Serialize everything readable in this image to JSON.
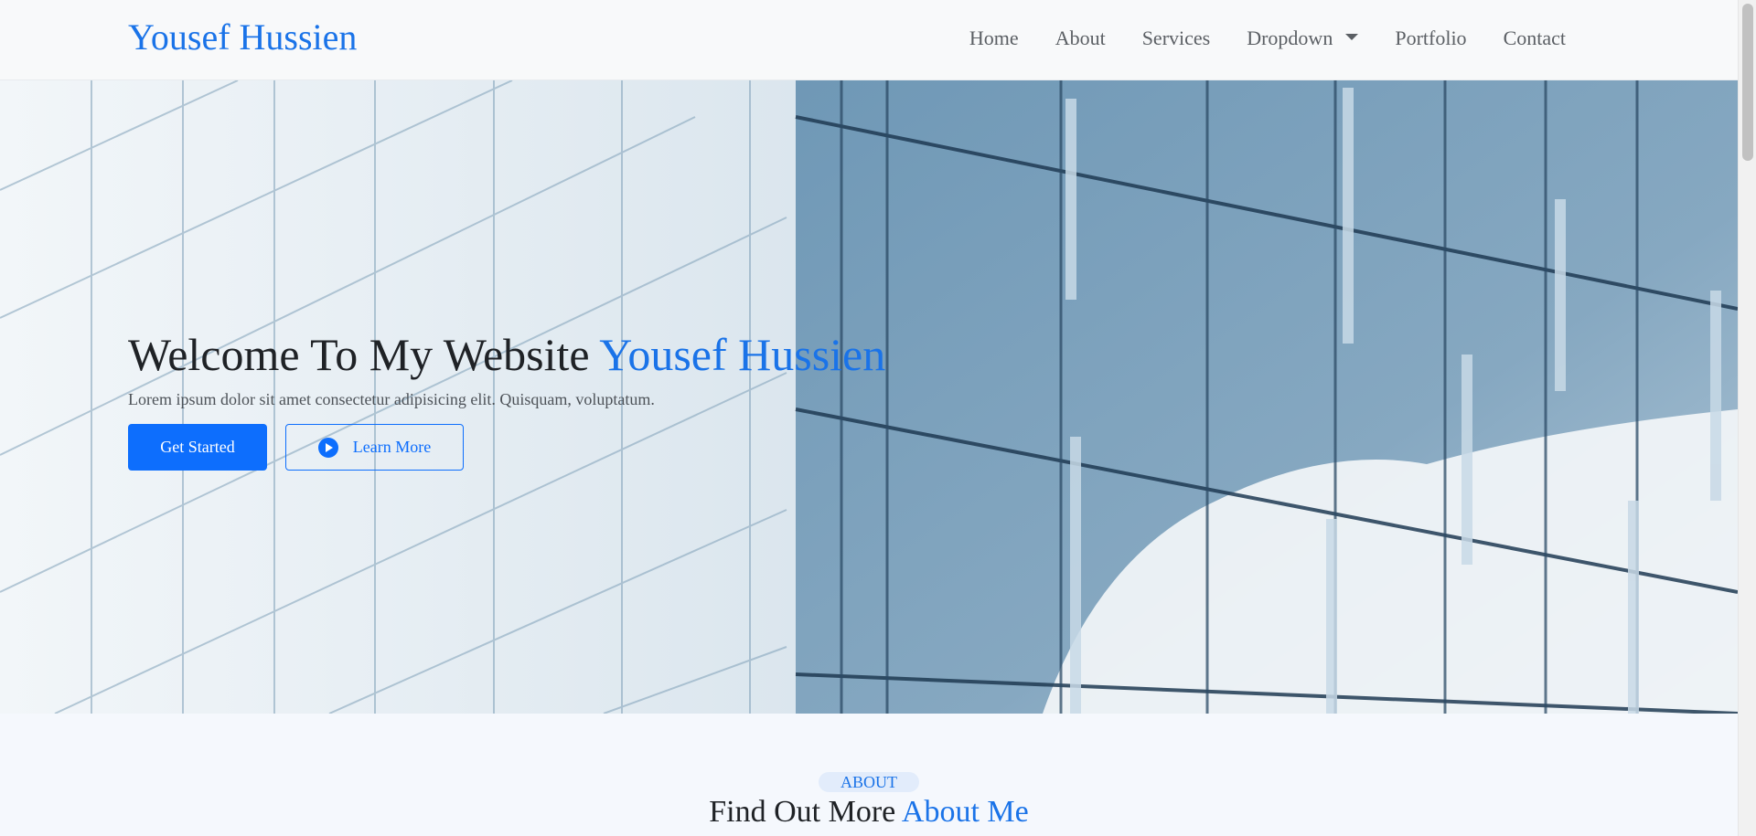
{
  "navbar": {
    "brand": "Yousef Hussien",
    "items": [
      {
        "label": "Home"
      },
      {
        "label": "About"
      },
      {
        "label": "Services"
      },
      {
        "label": "Dropdown"
      },
      {
        "label": "Portfolio"
      },
      {
        "label": "Contact"
      }
    ]
  },
  "hero": {
    "title_prefix": "Welcome To My Website",
    "title_accent": "Yousef Hussien",
    "subtitle": "Lorem ipsum dolor sit amet consectetur adipisicing elit. Quisquam, voluptatum.",
    "primary_button": "Get Started",
    "secondary_button": "Learn More",
    "secondary_button_icon": "play-circle-icon"
  },
  "about": {
    "badge": "ABOUT",
    "title_prefix": "Find Out More",
    "title_accent": "About Me"
  },
  "colors": {
    "accent": "#1a73e8",
    "primary_button": "#0d6efd",
    "navbar_bg": "#f8f9fa",
    "page_bg": "#f5f8fd"
  }
}
